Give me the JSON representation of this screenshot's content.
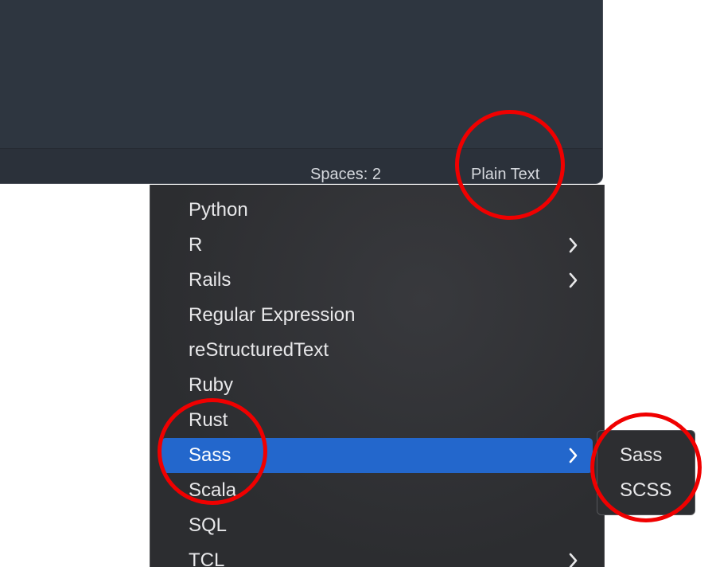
{
  "status_bar": {
    "spaces_label": "Spaces: 2",
    "syntax_label": "Plain Text"
  },
  "syntax_menu": {
    "items": [
      {
        "label": "Python",
        "has_submenu": false
      },
      {
        "label": "R",
        "has_submenu": true
      },
      {
        "label": "Rails",
        "has_submenu": true
      },
      {
        "label": "Regular Expression",
        "has_submenu": false
      },
      {
        "label": "reStructuredText",
        "has_submenu": false
      },
      {
        "label": "Ruby",
        "has_submenu": false
      },
      {
        "label": "Rust",
        "has_submenu": false
      },
      {
        "label": "Sass",
        "has_submenu": true,
        "selected": true
      },
      {
        "label": "Scala",
        "has_submenu": false
      },
      {
        "label": "SQL",
        "has_submenu": false
      },
      {
        "label": "TCL",
        "has_submenu": true
      }
    ]
  },
  "sass_submenu": {
    "items": [
      {
        "label": "Sass"
      },
      {
        "label": "SCSS"
      }
    ]
  },
  "colors": {
    "selection": "#2367cc",
    "annotation": "#f00000",
    "menu_background": "#2d2e31",
    "editor_background": "#2e3640"
  },
  "icons": {
    "submenu_arrow": "chevron-right-icon"
  }
}
